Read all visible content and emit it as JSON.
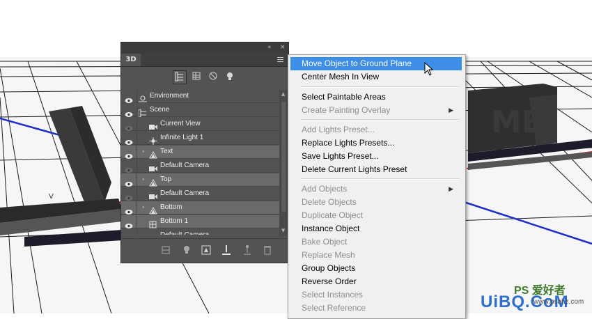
{
  "panel": {
    "tab_label": "3D",
    "collapse_glyph": "«",
    "close_glyph": "×",
    "filter_buttons": [
      "scene-filter-icon",
      "mesh-filter-icon",
      "material-filter-icon",
      "light-filter-icon"
    ],
    "tree": [
      {
        "label": "Environment",
        "icon": "environment-icon",
        "visible": true,
        "selected": false
      },
      {
        "label": "Scene",
        "icon": "scene-icon",
        "visible": true,
        "selected": false
      },
      {
        "label": "Current View",
        "icon": "camera-icon",
        "visible": false,
        "selected": false
      },
      {
        "label": "Infinite Light 1",
        "icon": "infinite-light-icon",
        "visible": true,
        "selected": false
      },
      {
        "label": "Text",
        "icon": "mesh-icon",
        "visible": true,
        "selected": true
      },
      {
        "label": "Default Camera",
        "icon": "camera-icon",
        "visible": false,
        "selected": false
      },
      {
        "label": "Top",
        "icon": "mesh-icon",
        "visible": true,
        "selected": true
      },
      {
        "label": "Default Camera",
        "icon": "camera-icon",
        "visible": false,
        "selected": false
      },
      {
        "label": "Bottom",
        "icon": "mesh-icon",
        "visible": true,
        "selected": true
      },
      {
        "label": "Bottom 1",
        "icon": "bottom-mesh-icon",
        "visible": true,
        "selected": true
      },
      {
        "label": "Default Camera",
        "icon": "camera-icon",
        "visible": false,
        "selected": false
      }
    ],
    "bottom_buttons": [
      "add-mesh-icon",
      "add-light-icon",
      "render-icon",
      "drop-to-ground-icon",
      "add-constraint-icon",
      "delete-icon"
    ]
  },
  "context_menu": {
    "items": [
      {
        "label": "Move Object to Ground Plane",
        "disabled": false,
        "highlighted": true,
        "submenu": false
      },
      {
        "label": "Center Mesh In View",
        "disabled": false,
        "highlighted": false,
        "submenu": false
      },
      {
        "label": "Select Paintable Areas",
        "disabled": false,
        "highlighted": false,
        "submenu": false
      },
      {
        "label": "Create Painting Overlay",
        "disabled": true,
        "highlighted": false,
        "submenu": true
      },
      {
        "label": "Add Lights Preset...",
        "disabled": true,
        "highlighted": false,
        "submenu": false
      },
      {
        "label": "Replace Lights Presets...",
        "disabled": false,
        "highlighted": false,
        "submenu": false
      },
      {
        "label": "Save Lights Preset...",
        "disabled": false,
        "highlighted": false,
        "submenu": false
      },
      {
        "label": "Delete Current Lights Preset",
        "disabled": false,
        "highlighted": false,
        "submenu": false
      },
      {
        "label": "Add Objects",
        "disabled": true,
        "highlighted": false,
        "submenu": true
      },
      {
        "label": "Delete Objects",
        "disabled": true,
        "highlighted": false,
        "submenu": false
      },
      {
        "label": "Duplicate Object",
        "disabled": true,
        "highlighted": false,
        "submenu": false
      },
      {
        "label": "Instance Object",
        "disabled": false,
        "highlighted": false,
        "submenu": false
      },
      {
        "label": "Bake Object",
        "disabled": true,
        "highlighted": false,
        "submenu": false
      },
      {
        "label": "Replace Mesh",
        "disabled": true,
        "highlighted": false,
        "submenu": false
      },
      {
        "label": "Group Objects",
        "disabled": false,
        "highlighted": false,
        "submenu": false
      },
      {
        "label": "Reverse Order",
        "disabled": false,
        "highlighted": false,
        "submenu": false
      },
      {
        "label": "Select Instances",
        "disabled": true,
        "highlighted": false,
        "submenu": false
      },
      {
        "label": "Select Reference",
        "disabled": true,
        "highlighted": false,
        "submenu": false
      }
    ]
  },
  "scene_text": {
    "left_letter": "V",
    "right_letters": "ME"
  },
  "watermark": {
    "line1": "PS 爱好者",
    "line2": "UiBQ.CoM",
    "url": "www.psahz.com"
  },
  "colors": {
    "highlight": "#3d8ee7",
    "panel_bg": "#535353",
    "x_axis": "#e0201a",
    "z_axis": "#1d2fc8"
  }
}
